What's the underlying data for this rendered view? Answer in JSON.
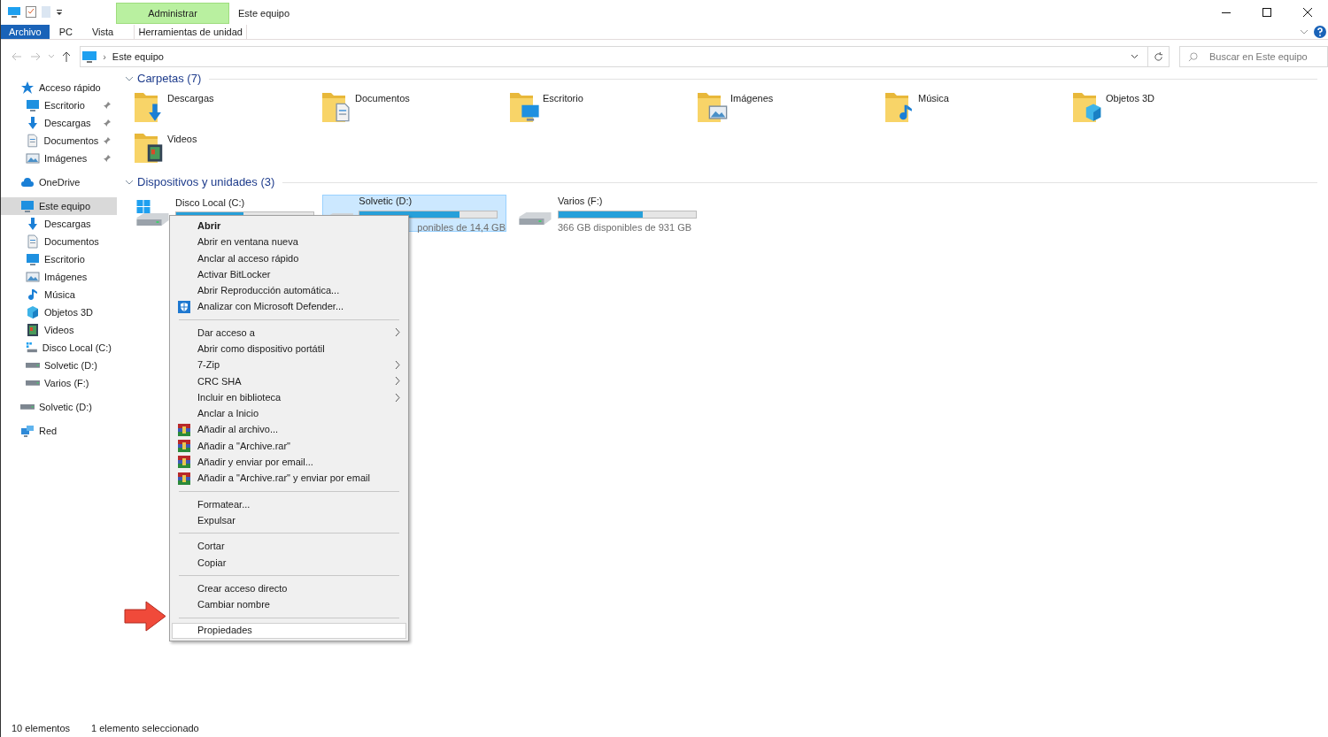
{
  "window": {
    "title": "Este equipo",
    "context_tab": "Administrar"
  },
  "ribbon_tabs": [
    {
      "label": "Archivo",
      "kind": "file"
    },
    {
      "label": "PC",
      "kind": "tab"
    },
    {
      "label": "Vista",
      "kind": "tab"
    },
    {
      "label": "Herramientas de unidad",
      "kind": "context"
    }
  ],
  "address": {
    "separator": "›",
    "path": "Este equipo"
  },
  "search": {
    "placeholder": "Buscar en Este equipo"
  },
  "sidebar": [
    {
      "label": "Acceso rápido",
      "kind": "star",
      "selected": false,
      "children": [
        {
          "label": "Escritorio",
          "kind": "desktop",
          "pinned": true,
          "selected": false
        },
        {
          "label": "Descargas",
          "kind": "download",
          "pinned": true,
          "selected": false
        },
        {
          "label": "Documentos",
          "kind": "document",
          "pinned": true,
          "selected": false
        },
        {
          "label": "Imágenes",
          "kind": "image",
          "pinned": true,
          "selected": false
        }
      ]
    },
    {
      "label": "OneDrive",
      "kind": "cloud",
      "selected": false
    },
    {
      "label": "Este equipo",
      "kind": "desktop",
      "selected": true,
      "children": [
        {
          "label": "Descargas",
          "kind": "download",
          "pinned": false,
          "selected": false
        },
        {
          "label": "Documentos",
          "kind": "document",
          "pinned": false,
          "selected": false
        },
        {
          "label": "Escritorio",
          "kind": "desktop",
          "pinned": false,
          "selected": false
        },
        {
          "label": "Imágenes",
          "kind": "image",
          "pinned": false,
          "selected": false
        },
        {
          "label": "Música",
          "kind": "music",
          "pinned": false,
          "selected": false
        },
        {
          "label": "Objetos 3D",
          "kind": "cube",
          "pinned": false,
          "selected": false
        },
        {
          "label": "Videos",
          "kind": "video",
          "pinned": false,
          "selected": false
        },
        {
          "label": "Disco Local (C:)",
          "kind": "windrive",
          "pinned": false,
          "selected": false
        },
        {
          "label": "Solvetic (D:)",
          "kind": "drive",
          "pinned": false,
          "selected": false
        },
        {
          "label": "Varios (F:)",
          "kind": "drive",
          "pinned": false,
          "selected": false
        }
      ]
    },
    {
      "label": "Solvetic (D:)",
      "kind": "drive",
      "selected": false
    },
    {
      "label": "Red",
      "kind": "network",
      "selected": false
    }
  ],
  "folders": {
    "title": "Carpetas (7)",
    "expanded": true,
    "items": [
      {
        "name": "Descargas",
        "kind": "download"
      },
      {
        "name": "Documentos",
        "kind": "document"
      },
      {
        "name": "Escritorio",
        "kind": "desktop"
      },
      {
        "name": "Imágenes",
        "kind": "image"
      },
      {
        "name": "Música",
        "kind": "music"
      },
      {
        "name": "Objetos 3D",
        "kind": "cube"
      },
      {
        "name": "Videos",
        "kind": "video"
      }
    ]
  },
  "drives": {
    "title": "Dispositivos y unidades (3)",
    "expanded": true,
    "items": [
      {
        "name": "Disco Local (C:)",
        "kind": "windrive",
        "level": 0.49,
        "selected": false
      },
      {
        "name": "Solvetic (D:)",
        "kind": "drive",
        "level": 0.73,
        "selected": true,
        "free": "ponibles de 14,4 GB"
      },
      {
        "name": "Varios (F:)",
        "kind": "drive",
        "level": 0.61,
        "selected": false,
        "free": "366 GB disponibles de 931 GB"
      }
    ]
  },
  "context_menu": {
    "groups": [
      [
        {
          "label": "Abrir",
          "bold": true,
          "selected": false
        },
        {
          "label": "Abrir en ventana nueva",
          "selected": false
        },
        {
          "label": "Anclar al acceso rápido",
          "selected": false
        },
        {
          "label": "Activar BitLocker",
          "selected": false
        },
        {
          "label": "Abrir Reproducción automática...",
          "selected": false
        },
        {
          "label": "Analizar con Microsoft Defender...",
          "kind": "defender",
          "selected": false
        }
      ],
      [
        {
          "label": "Dar acceso a",
          "submenu": true,
          "selected": false
        },
        {
          "label": "Abrir como dispositivo portátil",
          "selected": false
        },
        {
          "label": "7-Zip",
          "submenu": true,
          "selected": false
        },
        {
          "label": "CRC SHA",
          "submenu": true,
          "selected": false
        },
        {
          "label": "Incluir en biblioteca",
          "submenu": true,
          "selected": false
        },
        {
          "label": "Anclar a Inicio",
          "selected": false
        },
        {
          "label": "Añadir al archivo...",
          "kind": "winrar",
          "selected": false
        },
        {
          "label": "Añadir a \"Archive.rar\"",
          "kind": "winrar",
          "selected": false
        },
        {
          "label": "Añadir y enviar por email...",
          "kind": "winrar",
          "selected": false
        },
        {
          "label": "Añadir a \"Archive.rar\" y enviar por email",
          "kind": "winrar",
          "selected": false
        }
      ],
      [
        {
          "label": "Formatear...",
          "selected": false
        },
        {
          "label": "Expulsar",
          "selected": false
        }
      ],
      [
        {
          "label": "Cortar",
          "selected": false
        },
        {
          "label": "Copiar",
          "selected": false
        }
      ],
      [
        {
          "label": "Crear acceso directo",
          "selected": false
        },
        {
          "label": "Cambiar nombre",
          "selected": false
        }
      ],
      [
        {
          "label": "Propiedades",
          "selected": true
        }
      ]
    ]
  },
  "status_bar": {
    "count": "10 elementos",
    "selection": "1 elemento seleccionado"
  }
}
